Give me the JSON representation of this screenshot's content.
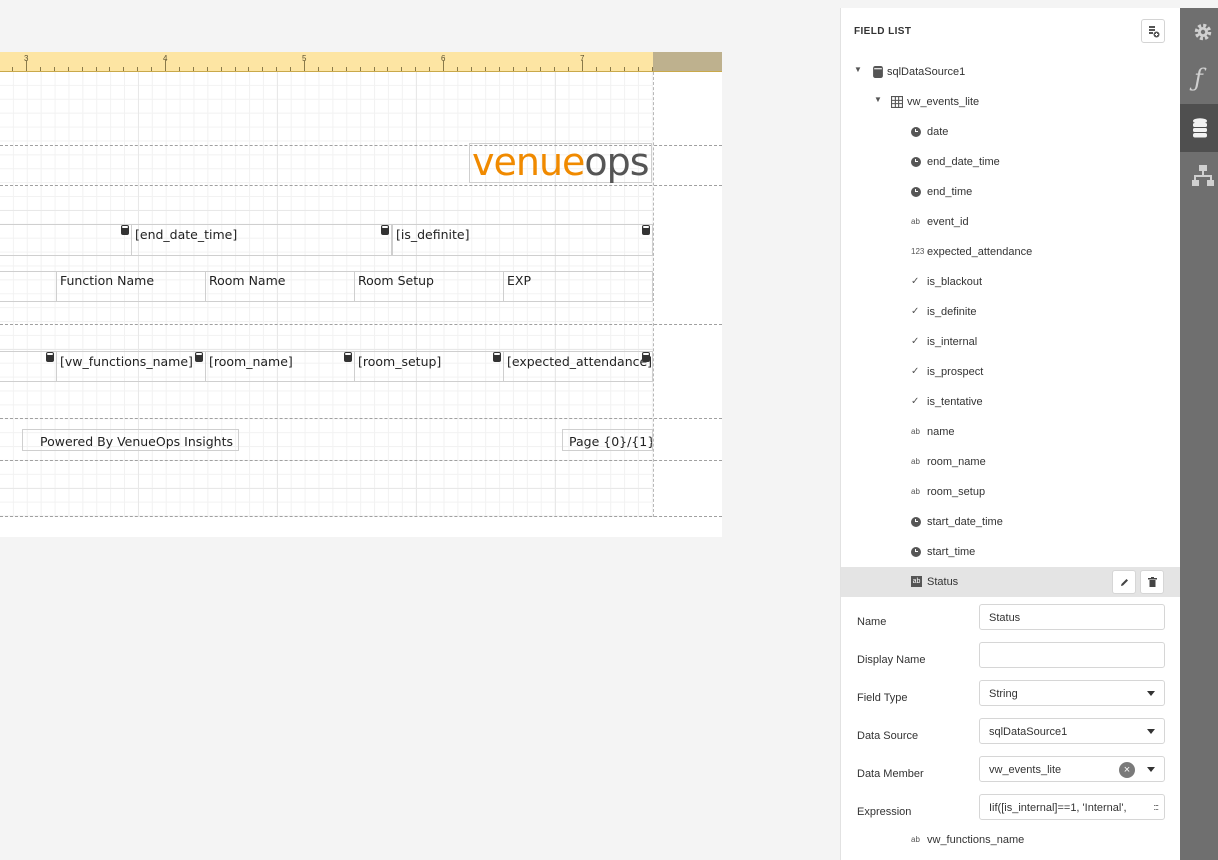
{
  "ruler": {
    "numbers": [
      "3",
      "4",
      "5",
      "6",
      "7"
    ]
  },
  "report": {
    "logo": {
      "part1": "venue",
      "part2": "ops"
    },
    "group_header": {
      "end_date_time": "[end_date_time]",
      "is_definite": "[is_definite]"
    },
    "column_headers": [
      "Function Name",
      "Room Name",
      "Room Setup",
      "EXP"
    ],
    "detail": [
      "[vw_functions_name]",
      "[room_name]",
      "[room_setup]",
      "[expected_attendance]"
    ],
    "footer": {
      "powered_by": "Powered By VenueOps Insights",
      "page": "Page {0}/{1}"
    }
  },
  "field_list": {
    "title": "FIELD LIST",
    "data_source": "sqlDataSource1",
    "table": "vw_events_lite",
    "fields": [
      {
        "name": "date",
        "type": "clock"
      },
      {
        "name": "end_date_time",
        "type": "clock"
      },
      {
        "name": "end_time",
        "type": "clock"
      },
      {
        "name": "event_id",
        "type": "ab"
      },
      {
        "name": "expected_attendance",
        "type": "123"
      },
      {
        "name": "is_blackout",
        "type": "check"
      },
      {
        "name": "is_definite",
        "type": "check"
      },
      {
        "name": "is_internal",
        "type": "check"
      },
      {
        "name": "is_prospect",
        "type": "check"
      },
      {
        "name": "is_tentative",
        "type": "check"
      },
      {
        "name": "name",
        "type": "ab"
      },
      {
        "name": "room_name",
        "type": "ab"
      },
      {
        "name": "room_setup",
        "type": "ab"
      },
      {
        "name": "start_date_time",
        "type": "clock"
      },
      {
        "name": "start_time",
        "type": "clock"
      },
      {
        "name": "Status",
        "type": "ab-box"
      }
    ],
    "type_glyphs": {
      "ab": "ab",
      "123": "123",
      "check": "✓"
    },
    "properties": {
      "name_label": "Name",
      "name_value": "Status",
      "display_name_label": "Display Name",
      "display_name_value": "",
      "field_type_label": "Field Type",
      "field_type_value": "String",
      "data_source_label": "Data Source",
      "data_source_value": "sqlDataSource1",
      "data_member_label": "Data Member",
      "data_member_value": "vw_events_lite",
      "expression_label": "Expression",
      "expression_value": "Iif([is_internal]==1, 'Internal', "
    },
    "next_field": "vw_functions_name"
  },
  "toolbar": {
    "items": [
      "gear-icon",
      "function-icon",
      "database-icon",
      "hierarchy-icon"
    ],
    "active": "database-icon"
  },
  "colors": {
    "logo_orange": "#f08a00",
    "ruler": "#fde5a3",
    "toolbar": "#6f6f6f"
  }
}
